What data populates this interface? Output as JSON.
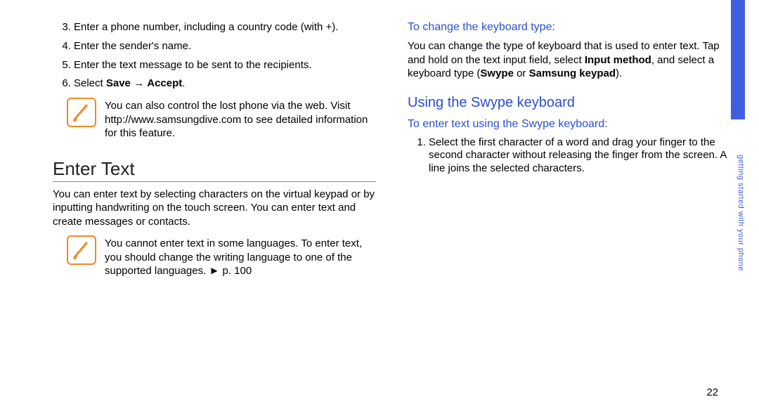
{
  "left": {
    "step3": "Enter a phone number, including a country code (with +).",
    "step4": "Enter the sender's name.",
    "step5": "Enter the text message to be sent to the recipients.",
    "step6_prefix": "Select ",
    "step6_bold1": "Save",
    "step6_arrow": " → ",
    "step6_bold2": "Accept",
    "step6_suffix": ".",
    "note1": "You can also control the lost phone via the web. Visit http://www.samsungdive.com to see detailed information for this feature.",
    "heading": "Enter Text",
    "body1": "You can enter text by selecting characters on the virtual keypad or by inputting handwriting on the touch screen. You can enter text and create messages or contacts.",
    "note2": "You cannot enter text in some languages. To enter text, you should change the writing language to one of the supported languages. ►  p. 100"
  },
  "right": {
    "sub1": "To change the keyboard type:",
    "body_a": "You can change the type of keyboard that is used to enter text. Tap and hold on the text input field, select ",
    "body_b_bold": "Input method",
    "body_c": ", and select a keyboard type (",
    "body_d_bold": "Swype",
    "body_e": " or ",
    "body_f_bold": "Samsung keypad",
    "body_g": ").",
    "h2": "Using the Swype keyboard",
    "sub2": "To enter text using the Swype keyboard:",
    "step1": "Select the first character of a word and drag your finger to the second character without releasing the finger from the screen. A line joins the selected characters."
  },
  "page_number": "22",
  "side_label": "getting started with your phone"
}
